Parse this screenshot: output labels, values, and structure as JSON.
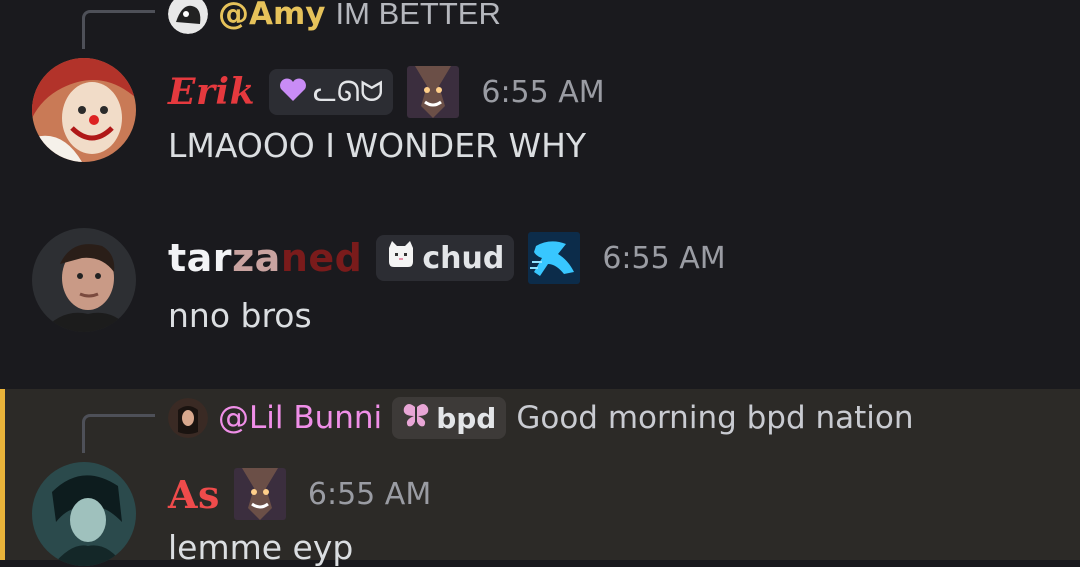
{
  "messages": [
    {
      "reply": {
        "name": "@Amy",
        "text": "IM BETTER",
        "name_color": "#e6c25a"
      },
      "author": {
        "name": "Erik",
        "color": "#e5393e"
      },
      "tag": {
        "text": "ᓚᘏᗢ",
        "icon": "purple-heart-icon"
      },
      "emote": "champion-emote",
      "time": "6:55 AM",
      "content": "LMAOOO I WONDER WHY"
    },
    {
      "author": {
        "name_parts": [
          "tar",
          "za",
          "ned"
        ],
        "colors": [
          "#f2f3f5",
          "#c9a3a0",
          "#7a1b1b"
        ]
      },
      "tag": {
        "text": "chud",
        "icon": "cat-icon"
      },
      "emote": "runner-emote",
      "time": "6:55 AM",
      "content": "nno bros"
    },
    {
      "reply": {
        "name": "@Lil Bunni",
        "tag_text": "bpd",
        "tag_icon": "butterfly-icon",
        "text": "Good morning bpd nation",
        "name_color": "#f08fe8"
      },
      "author": {
        "name": "As",
        "color": "#ef4b4b"
      },
      "emote": "champion-emote",
      "time": "6:55 AM",
      "content": "lemme eyp"
    }
  ],
  "colors": {
    "background": "#1a1a1e",
    "highlight": "#2c2a27",
    "highlight_bar": "#e9b33a",
    "timestamp": "#9a9ca3"
  }
}
